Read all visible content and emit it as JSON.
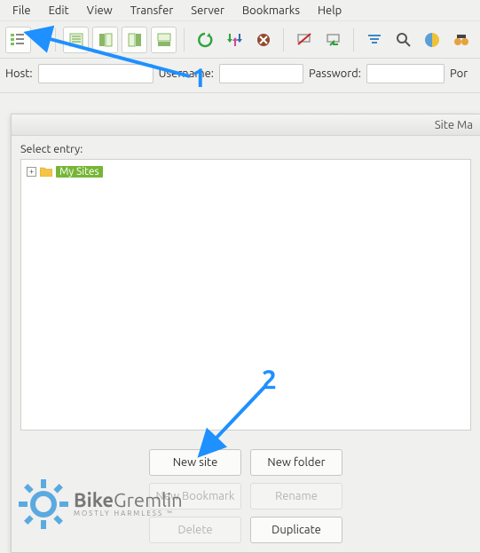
{
  "menu": {
    "file": "File",
    "edit": "Edit",
    "view": "View",
    "transfer": "Transfer",
    "server": "Server",
    "bookmarks": "Bookmarks",
    "help": "Help"
  },
  "quickconnect": {
    "host_label": "Host:",
    "username_label": "Username:",
    "password_label": "Password:",
    "port_label": "Por",
    "host_value": "",
    "username_value": "",
    "password_value": ""
  },
  "site_manager": {
    "title": "Site Ma",
    "select_entry_label": "Select entry:",
    "root_label": "My Sites",
    "buttons": {
      "new_site": "New site",
      "new_folder": "New folder",
      "new_bookmark": "New Bookmark",
      "rename": "Rename",
      "delete": "Delete",
      "duplicate": "Duplicate"
    }
  },
  "watermark": {
    "main_a": "Bike",
    "main_b": "Gremlin",
    "sub": "MOSTLY HARMLESS ™"
  },
  "annotations": {
    "num1": "1",
    "num2": "2"
  },
  "colors": {
    "accent_blue": "#1e90ff",
    "tree_highlight": "#76b536"
  }
}
